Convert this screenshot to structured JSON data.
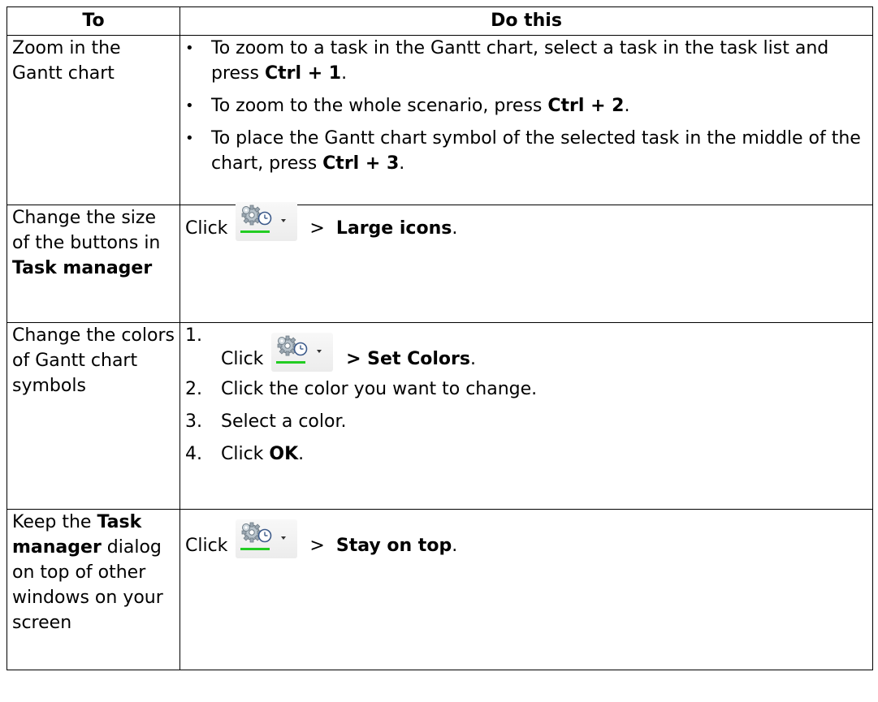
{
  "table": {
    "headers": {
      "to": "To",
      "do": "Do this"
    },
    "zoom_row": {
      "to": "Zoom in the Gantt chart",
      "bullets": [
        {
          "marker": "•",
          "pre": "To zoom to a task in the Gantt chart, select a task in the task list and press ",
          "bold": "Ctrl + 1",
          "post": "."
        },
        {
          "marker": "•",
          "pre": "To zoom to the whole scenario, press ",
          "bold": "Ctrl + 2",
          "post": "."
        },
        {
          "marker": "•",
          "pre": "To place the Gantt chart symbol of the selected task in the middle of the chart, press ",
          "bold": "Ctrl + 3",
          "post": "."
        }
      ]
    },
    "size_row": {
      "to_pre": "Change the size of the buttons in ",
      "to_bold": "Task manager",
      "click": "Click",
      "sep": " > ",
      "bold": "Large icons",
      "post": "."
    },
    "colors_row": {
      "to": "Change the colors of Gantt chart symbols",
      "steps": [
        {
          "num": "1.",
          "click": "Click",
          "bold": " > Set Colors",
          "post": "."
        },
        {
          "num": "2.",
          "text": "Click the color you want to change."
        },
        {
          "num": "3.",
          "text": "Select a color."
        },
        {
          "num": "4.",
          "pre": "Click ",
          "bold": "OK",
          "post": "."
        }
      ]
    },
    "top_row": {
      "to_pre": "Keep the ",
      "to_bold": "Task manager",
      "to_post": " dialog on top of other windows on your screen",
      "click": "Click",
      "sep": " > ",
      "bold": "Stay on top",
      "post": "."
    }
  },
  "icon": {
    "name": "task-manager-options-icon",
    "accent": "#22cc22"
  }
}
